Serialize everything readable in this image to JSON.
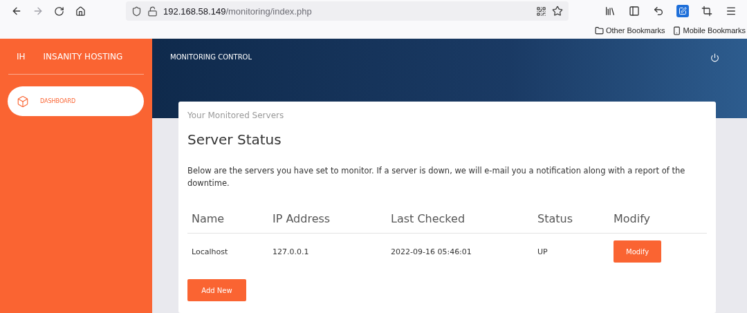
{
  "browser": {
    "url_host": "192.168.58.149",
    "url_path": "/monitoring/index.php",
    "bookmarks": [
      "Other Bookmarks",
      "Mobile Bookmarks"
    ]
  },
  "sidebar": {
    "logo_short": "IH",
    "brand": "INSANITY HOSTING",
    "items": [
      {
        "label": "DASHBOARD",
        "selected": true
      }
    ]
  },
  "header": {
    "title": "MONITORING CONTROL"
  },
  "card": {
    "subtitle": "Your Monitored Servers",
    "title": "Server Status",
    "description": "Below are the servers you have set to monitor. If a server is down, we will e-mail you a notification along with a report of the downtime.",
    "table": {
      "columns": [
        "Name",
        "IP Address",
        "Last Checked",
        "Status",
        "Modify"
      ],
      "rows": [
        {
          "name": "Localhost",
          "ip": "127.0.0.1",
          "last_checked": "2022-09-16 05:46:01",
          "status": "UP",
          "action": "Modify"
        }
      ]
    },
    "add_button": "Add New"
  }
}
